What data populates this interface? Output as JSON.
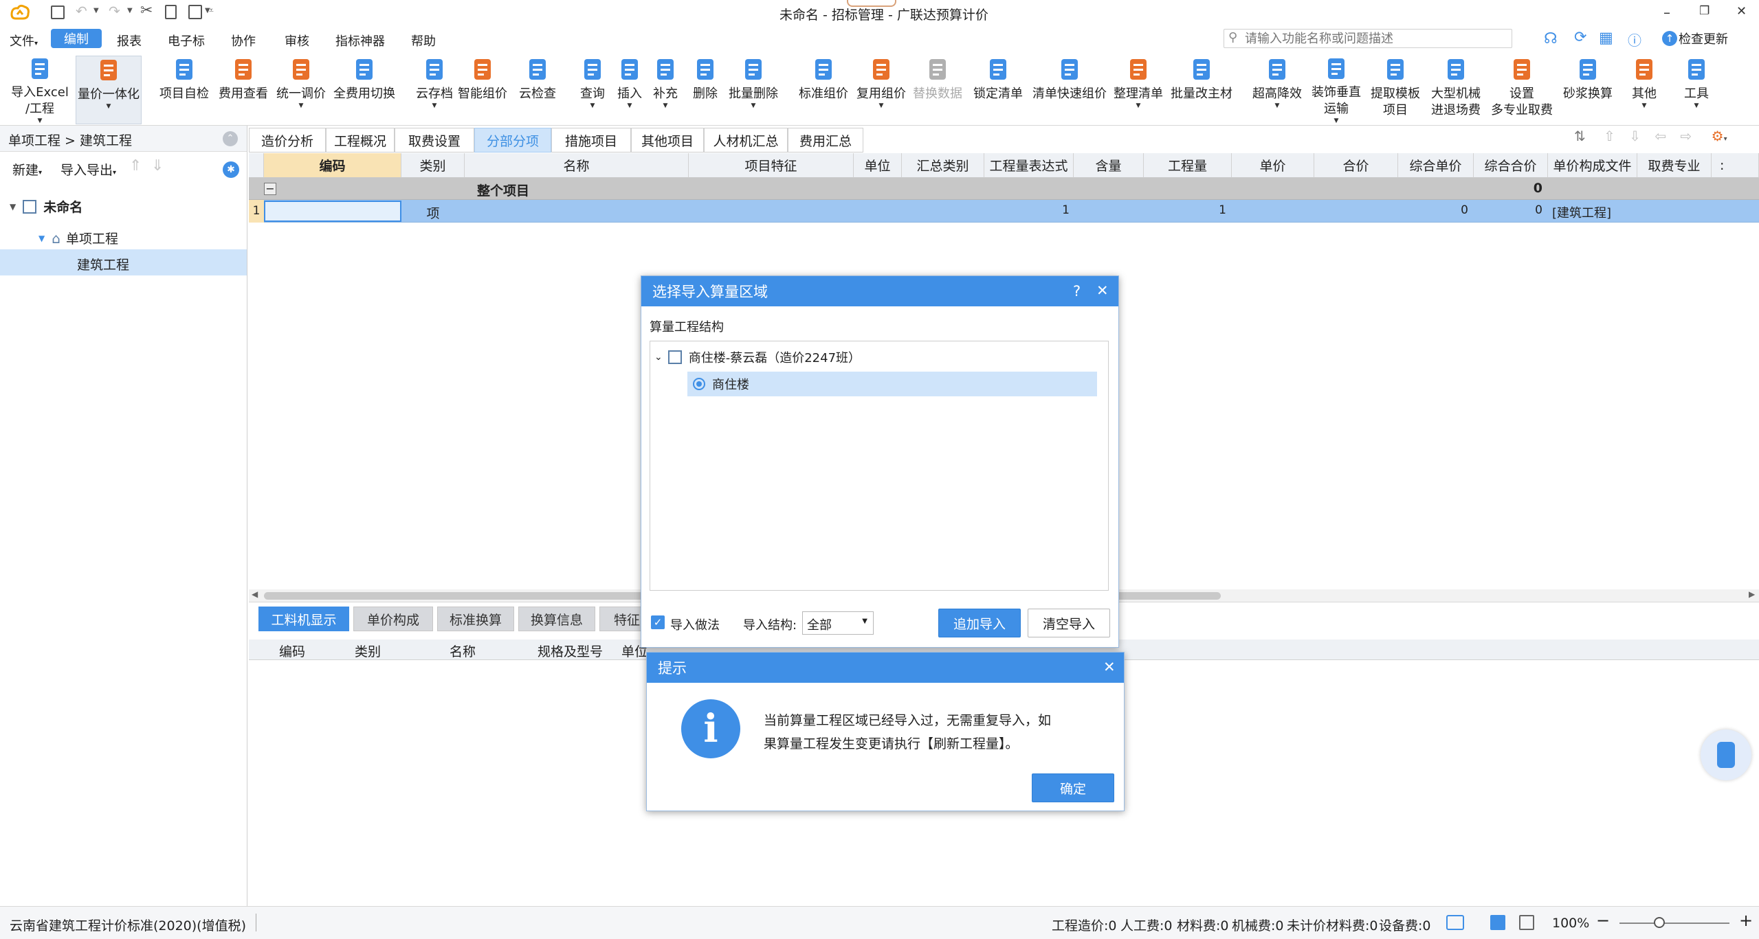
{
  "window": {
    "title": "未命名 - 招标管理 - 广联达预算计价",
    "minimize": "–",
    "restore": "❐",
    "close": "✕"
  },
  "search": {
    "placeholder": "请输入功能名称或问题描述"
  },
  "check_update": "检查更新",
  "menu": [
    "文件",
    "编制",
    "报表",
    "电子标",
    "协作",
    "审核",
    "指标神器",
    "帮助"
  ],
  "ribbon": [
    {
      "l1": "导入Excel",
      "l2": "/工程",
      "dd": true,
      "icon": "import-excel-icon",
      "color": "#3f8fe6"
    },
    {
      "l1": "量价一体化",
      "l2": "",
      "dd": true,
      "icon": "integration-icon",
      "color": "#e8702a"
    },
    {
      "l1": "项目自检",
      "l2": "",
      "dd": false,
      "icon": "self-check-icon",
      "color": "#3f8fe6"
    },
    {
      "l1": "费用查看",
      "l2": "",
      "dd": false,
      "icon": "fee-view-icon",
      "color": "#e8702a"
    },
    {
      "l1": "统一调价",
      "l2": "",
      "dd": true,
      "icon": "price-adjust-icon",
      "color": "#e8702a"
    },
    {
      "l1": "全费用切换",
      "l2": "",
      "dd": false,
      "icon": "fee-switch-icon",
      "color": "#3f8fe6"
    },
    {
      "l1": "云存档",
      "l2": "",
      "dd": true,
      "icon": "cloud-archive-icon",
      "color": "#3f8fe6"
    },
    {
      "l1": "智能组价",
      "l2": "",
      "dd": false,
      "icon": "smart-price-icon",
      "color": "#e8702a"
    },
    {
      "l1": "云检查",
      "l2": "",
      "dd": false,
      "icon": "cloud-check-icon",
      "color": "#3f8fe6"
    },
    {
      "l1": "查询",
      "l2": "",
      "dd": true,
      "icon": "query-icon",
      "color": "#3f8fe6"
    },
    {
      "l1": "插入",
      "l2": "",
      "dd": true,
      "icon": "insert-icon",
      "color": "#3f8fe6"
    },
    {
      "l1": "补充",
      "l2": "",
      "dd": true,
      "icon": "supplement-icon",
      "color": "#3f8fe6"
    },
    {
      "l1": "删除",
      "l2": "",
      "dd": false,
      "icon": "delete-icon",
      "color": "#3f8fe6"
    },
    {
      "l1": "批量删除",
      "l2": "",
      "dd": true,
      "icon": "batch-delete-icon",
      "color": "#3f8fe6"
    },
    {
      "l1": "标准组价",
      "l2": "",
      "dd": false,
      "icon": "standard-price-icon",
      "color": "#3f8fe6"
    },
    {
      "l1": "复用组价",
      "l2": "",
      "dd": true,
      "icon": "reuse-price-icon",
      "color": "#e8702a"
    },
    {
      "l1": "替换数据",
      "l2": "",
      "dd": false,
      "icon": "replace-data-icon",
      "color": "#b0b0b0",
      "gray": true
    },
    {
      "l1": "锁定清单",
      "l2": "",
      "dd": false,
      "icon": "lock-list-icon",
      "color": "#3f8fe6"
    },
    {
      "l1": "清单快速组价",
      "l2": "",
      "dd": false,
      "icon": "quick-price-icon",
      "color": "#3f8fe6"
    },
    {
      "l1": "整理清单",
      "l2": "",
      "dd": true,
      "icon": "organize-list-icon",
      "color": "#e8702a"
    },
    {
      "l1": "批量改主材",
      "l2": "",
      "dd": false,
      "icon": "batch-material-icon",
      "color": "#3f8fe6"
    },
    {
      "l1": "超高降效",
      "l2": "",
      "dd": true,
      "icon": "high-rise-icon",
      "color": "#3f8fe6"
    },
    {
      "l1": "装饰垂直",
      "l2": "运输",
      "dd": true,
      "icon": "vertical-transport-icon",
      "color": "#3f8fe6"
    },
    {
      "l1": "提取模板",
      "l2": "项目",
      "dd": false,
      "icon": "template-icon",
      "color": "#3f8fe6"
    },
    {
      "l1": "大型机械",
      "l2": "进退场费",
      "dd": false,
      "icon": "machinery-icon",
      "color": "#3f8fe6"
    },
    {
      "l1": "设置",
      "l2": "多专业取费",
      "dd": false,
      "icon": "multi-fee-icon",
      "color": "#e8702a"
    },
    {
      "l1": "砂浆换算",
      "l2": "",
      "dd": false,
      "icon": "mortar-icon",
      "color": "#3f8fe6"
    },
    {
      "l1": "其他",
      "l2": "",
      "dd": true,
      "icon": "other-icon",
      "color": "#e8702a"
    },
    {
      "l1": "工具",
      "l2": "",
      "dd": true,
      "icon": "tools-icon",
      "color": "#3f8fe6"
    }
  ],
  "left": {
    "breadcrumb": "单项工程 > 建筑工程",
    "new_label": "新建",
    "import_export_label": "导入导出",
    "tree": {
      "root": "未命名",
      "child": "单项工程",
      "leaf": "建筑工程"
    }
  },
  "tabs": [
    "造价分析",
    "工程概况",
    "取费设置",
    "分部分项",
    "措施项目",
    "其他项目",
    "人材机汇总",
    "费用汇总"
  ],
  "grid": {
    "columns": [
      "编码",
      "类别",
      "名称",
      "项目特征",
      "单位",
      "汇总类别",
      "工程量表达式",
      "含量",
      "工程量",
      "单价",
      "合价",
      "综合单价",
      "综合合价",
      "单价构成文件",
      "取费专业"
    ],
    "total_row": {
      "collapse": "−",
      "name": "整个项目",
      "total": "0"
    },
    "row1": {
      "num": "1",
      "code": "",
      "type": "项",
      "expr": "1",
      "qty": "1",
      "unit_price": "0",
      "total": "0",
      "file": "[建筑工程]"
    }
  },
  "bottom": {
    "tabs": [
      "工料机显示",
      "单价构成",
      "标准换算",
      "换算信息",
      "特征"
    ],
    "columns": [
      "编码",
      "类别",
      "名称",
      "规格及型号",
      "单位"
    ]
  },
  "dialog_region": {
    "title": "选择导入算量区域",
    "help": "?",
    "close": "✕",
    "section_label": "算量工程结构",
    "tree_root": "商住楼-蔡云磊（造价2247班）",
    "tree_child": "商住楼",
    "checkbox_label": "导入做法",
    "struct_label": "导入结构:",
    "struct_value": "全部",
    "append_btn": "追加导入",
    "clear_btn": "清空导入"
  },
  "dialog_tip": {
    "title": "提示",
    "close": "✕",
    "message_line1": "当前算量工程区域已经导入过，无需重复导入，如",
    "message_line2": "果算量工程发生变更请执行【刷新工程量】。",
    "ok": "确定"
  },
  "status": {
    "standard": "云南省建筑工程计价标准(2020)(增值税)",
    "cost": "工程造价:0",
    "labor": "人工费:0",
    "material": "材料费:0",
    "machine": "机械费:0",
    "unpriced": "未计价材料费:0",
    "equipment": "设备费:0",
    "zoom": "100%"
  },
  "colors": {
    "accent": "#3f8fe6",
    "orange": "#e8702a",
    "selected_row": "#9ec6f2",
    "header_bg": "#eef1f5"
  }
}
